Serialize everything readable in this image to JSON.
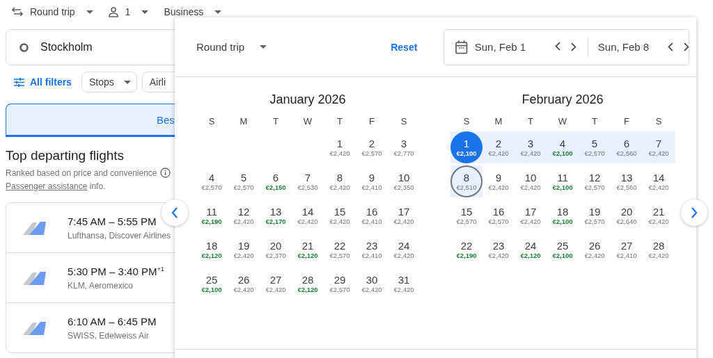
{
  "trip_bar": {
    "trip_type": "Round trip",
    "passengers": "1",
    "cabin": "Business"
  },
  "origin": {
    "value": "Stockholm"
  },
  "filters": {
    "all_filters": "All filters",
    "chips": [
      "Stops",
      "Airli"
    ]
  },
  "sort_tab": {
    "label": "Bes"
  },
  "results": {
    "title": "Top departing flights",
    "subtitle": "Ranked based on price and convenience",
    "assistance_link": "Passenger assistance",
    "assistance_suffix": "info.",
    "flights": [
      {
        "times": "7:45 AM – 5:55 PM",
        "airlines": "Lufthansa, Discover Airlines"
      },
      {
        "times": "5:30 PM – 3:40 PM$^{+1}$",
        "airlines": "KLM, Aeromexico"
      },
      {
        "times": "6:10 AM – 6:45 PM",
        "airlines": "SWISS, Edelweiss Air"
      }
    ]
  },
  "date_picker": {
    "trip_type": "Round trip",
    "reset": "Reset",
    "departure": "Sun, Feb 1",
    "return": "Sun, Feb 8",
    "months": [
      {
        "title": "January 2026",
        "weekdays": [
          "S",
          "M",
          "T",
          "W",
          "T",
          "F",
          "S"
        ],
        "weeks": [
          {
            "right_aligned": true,
            "days": [
              {
                "day": "1",
                "price": "€2,420",
                "cheap": false,
                "selected": false,
                "return": false,
                "in_range": false
              },
              {
                "day": "2",
                "price": "€2,570",
                "cheap": false,
                "selected": false,
                "return": false,
                "in_range": false
              },
              {
                "day": "3",
                "price": "€2,770",
                "cheap": false,
                "selected": false,
                "return": false,
                "in_range": false
              }
            ]
          },
          {
            "right_aligned": false,
            "days": [
              {
                "day": "4",
                "price": "€2,570",
                "cheap": false,
                "selected": false,
                "return": false,
                "in_range": false
              },
              {
                "day": "5",
                "price": "€2,570",
                "cheap": false,
                "selected": false,
                "return": false,
                "in_range": false
              },
              {
                "day": "6",
                "price": "€2,150",
                "cheap": true,
                "selected": false,
                "return": false,
                "in_range": false
              },
              {
                "day": "7",
                "price": "€2,530",
                "cheap": false,
                "selected": false,
                "return": false,
                "in_range": false
              },
              {
                "day": "8",
                "price": "€2,420",
                "cheap": false,
                "selected": false,
                "return": false,
                "in_range": false
              },
              {
                "day": "9",
                "price": "€2,410",
                "cheap": false,
                "selected": false,
                "return": false,
                "in_range": false
              },
              {
                "day": "10",
                "price": "€2,350",
                "cheap": false,
                "selected": false,
                "return": false,
                "in_range": false
              }
            ]
          },
          {
            "right_aligned": false,
            "days": [
              {
                "day": "11",
                "price": "€2,190",
                "cheap": true,
                "selected": false,
                "return": false,
                "in_range": false
              },
              {
                "day": "12",
                "price": "€2,420",
                "cheap": false,
                "selected": false,
                "return": false,
                "in_range": false
              },
              {
                "day": "13",
                "price": "€2,170",
                "cheap": true,
                "selected": false,
                "return": false,
                "in_range": false
              },
              {
                "day": "14",
                "price": "€2,420",
                "cheap": false,
                "selected": false,
                "return": false,
                "in_range": false
              },
              {
                "day": "15",
                "price": "€2,420",
                "cheap": false,
                "selected": false,
                "return": false,
                "in_range": false
              },
              {
                "day": "16",
                "price": "€2,410",
                "cheap": false,
                "selected": false,
                "return": false,
                "in_range": false
              },
              {
                "day": "17",
                "price": "€2,420",
                "cheap": false,
                "selected": false,
                "return": false,
                "in_range": false
              }
            ]
          },
          {
            "right_aligned": false,
            "days": [
              {
                "day": "18",
                "price": "€2,120",
                "cheap": true,
                "selected": false,
                "return": false,
                "in_range": false
              },
              {
                "day": "19",
                "price": "€2,420",
                "cheap": false,
                "selected": false,
                "return": false,
                "in_range": false
              },
              {
                "day": "20",
                "price": "€2,370",
                "cheap": false,
                "selected": false,
                "return": false,
                "in_range": false
              },
              {
                "day": "21",
                "price": "€2,120",
                "cheap": true,
                "selected": false,
                "return": false,
                "in_range": false
              },
              {
                "day": "22",
                "price": "€2,570",
                "cheap": false,
                "selected": false,
                "return": false,
                "in_range": false
              },
              {
                "day": "23",
                "price": "€2,410",
                "cheap": false,
                "selected": false,
                "return": false,
                "in_range": false
              },
              {
                "day": "24",
                "price": "€2,420",
                "cheap": false,
                "selected": false,
                "return": false,
                "in_range": false
              }
            ]
          },
          {
            "right_aligned": false,
            "days": [
              {
                "day": "25",
                "price": "€2,100",
                "cheap": true,
                "selected": false,
                "return": false,
                "in_range": false
              },
              {
                "day": "26",
                "price": "€2,420",
                "cheap": false,
                "selected": false,
                "return": false,
                "in_range": false
              },
              {
                "day": "27",
                "price": "€2,420",
                "cheap": false,
                "selected": false,
                "return": false,
                "in_range": false
              },
              {
                "day": "28",
                "price": "€2,120",
                "cheap": true,
                "selected": false,
                "return": false,
                "in_range": false
              },
              {
                "day": "29",
                "price": "€2,570",
                "cheap": false,
                "selected": false,
                "return": false,
                "in_range": false
              },
              {
                "day": "30",
                "price": "€2,420",
                "cheap": false,
                "selected": false,
                "return": false,
                "in_range": false
              },
              {
                "day": "31",
                "price": "€2,420",
                "cheap": false,
                "selected": false,
                "return": false,
                "in_range": false
              }
            ]
          }
        ]
      },
      {
        "title": "February 2026",
        "weekdays": [
          "S",
          "M",
          "T",
          "W",
          "T",
          "F",
          "S"
        ],
        "weeks": [
          {
            "right_aligned": false,
            "days": [
              {
                "day": "1",
                "price": "€2,100",
                "cheap": true,
                "selected": true,
                "return": false,
                "in_range": true
              },
              {
                "day": "2",
                "price": "€2,420",
                "cheap": false,
                "selected": false,
                "return": false,
                "in_range": true
              },
              {
                "day": "3",
                "price": "€2,420",
                "cheap": false,
                "selected": false,
                "return": false,
                "in_range": true
              },
              {
                "day": "4",
                "price": "€2,100",
                "cheap": true,
                "selected": false,
                "return": false,
                "in_range": true
              },
              {
                "day": "5",
                "price": "€2,570",
                "cheap": false,
                "selected": false,
                "return": false,
                "in_range": true
              },
              {
                "day": "6",
                "price": "€2,560",
                "cheap": false,
                "selected": false,
                "return": false,
                "in_range": true
              },
              {
                "day": "7",
                "price": "€2,420",
                "cheap": false,
                "selected": false,
                "return": false,
                "in_range": true
              }
            ]
          },
          {
            "right_aligned": false,
            "days": [
              {
                "day": "8",
                "price": "€2,510",
                "cheap": false,
                "selected": false,
                "return": true,
                "in_range": true
              },
              {
                "day": "9",
                "price": "€2,420",
                "cheap": false,
                "selected": false,
                "return": false,
                "in_range": false
              },
              {
                "day": "10",
                "price": "€2,420",
                "cheap": false,
                "selected": false,
                "return": false,
                "in_range": false
              },
              {
                "day": "11",
                "price": "€2,100",
                "cheap": true,
                "selected": false,
                "return": false,
                "in_range": false
              },
              {
                "day": "12",
                "price": "€2,570",
                "cheap": false,
                "selected": false,
                "return": false,
                "in_range": false
              },
              {
                "day": "13",
                "price": "€2,560",
                "cheap": false,
                "selected": false,
                "return": false,
                "in_range": false
              },
              {
                "day": "14",
                "price": "€2,420",
                "cheap": false,
                "selected": false,
                "return": false,
                "in_range": false
              }
            ]
          },
          {
            "right_aligned": false,
            "days": [
              {
                "day": "15",
                "price": "€2,570",
                "cheap": false,
                "selected": false,
                "return": false,
                "in_range": false
              },
              {
                "day": "16",
                "price": "€2,570",
                "cheap": false,
                "selected": false,
                "return": false,
                "in_range": false
              },
              {
                "day": "17",
                "price": "€2,420",
                "cheap": false,
                "selected": false,
                "return": false,
                "in_range": false
              },
              {
                "day": "18",
                "price": "€2,100",
                "cheap": true,
                "selected": false,
                "return": false,
                "in_range": false
              },
              {
                "day": "19",
                "price": "€2,570",
                "cheap": false,
                "selected": false,
                "return": false,
                "in_range": false
              },
              {
                "day": "20",
                "price": "€2,640",
                "cheap": false,
                "selected": false,
                "return": false,
                "in_range": false
              },
              {
                "day": "21",
                "price": "€2,420",
                "cheap": false,
                "selected": false,
                "return": false,
                "in_range": false
              }
            ]
          },
          {
            "right_aligned": false,
            "days": [
              {
                "day": "22",
                "price": "€2,190",
                "cheap": true,
                "selected": false,
                "return": false,
                "in_range": false
              },
              {
                "day": "23",
                "price": "€2,420",
                "cheap": false,
                "selected": false,
                "return": false,
                "in_range": false
              },
              {
                "day": "24",
                "price": "€2,120",
                "cheap": true,
                "selected": false,
                "return": false,
                "in_range": false
              },
              {
                "day": "25",
                "price": "€2,100",
                "cheap": true,
                "selected": false,
                "return": false,
                "in_range": false
              },
              {
                "day": "26",
                "price": "€2,420",
                "cheap": false,
                "selected": false,
                "return": false,
                "in_range": false
              },
              {
                "day": "27",
                "price": "€2,410",
                "cheap": false,
                "selected": false,
                "return": false,
                "in_range": false
              },
              {
                "day": "28",
                "price": "€2,420",
                "cheap": false,
                "selected": false,
                "return": false,
                "in_range": false
              }
            ]
          }
        ]
      }
    ]
  }
}
